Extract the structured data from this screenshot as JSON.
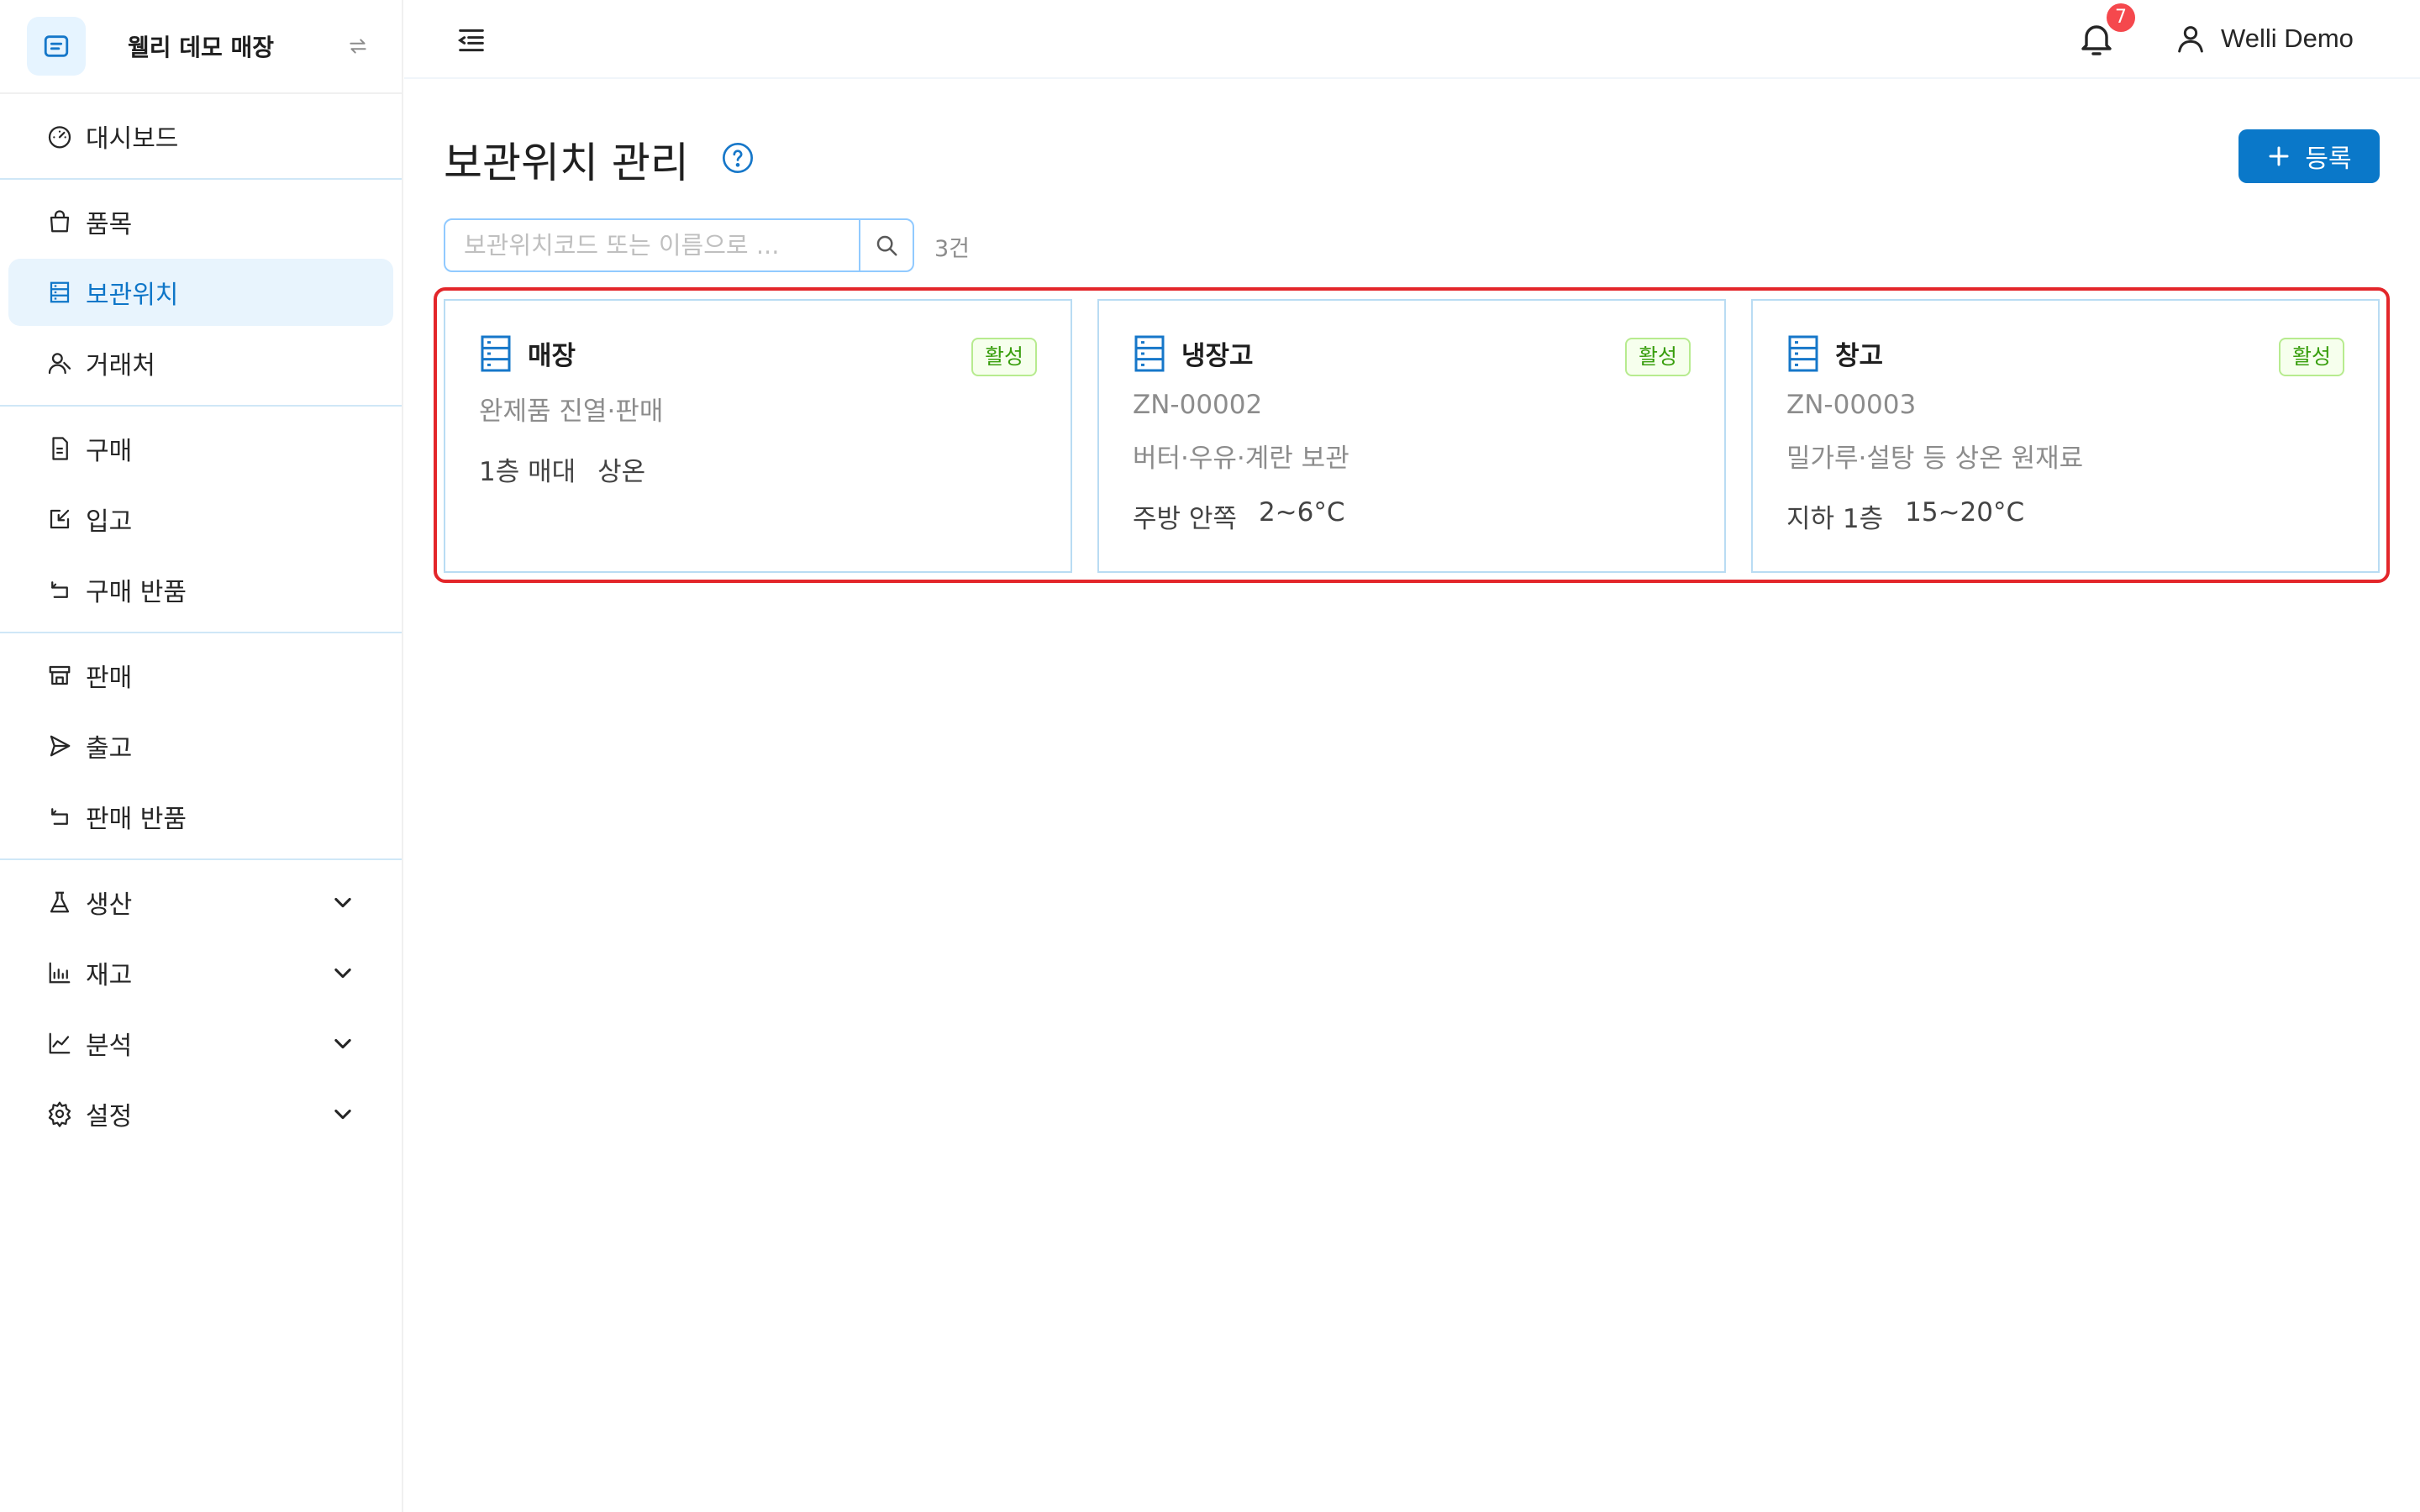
{
  "brand": {
    "name": "웰리 데모 매장"
  },
  "sidebar": {
    "groups": [
      [
        {
          "label": "대시보드",
          "icon": "dashboard-icon"
        }
      ],
      [
        {
          "label": "품목",
          "icon": "bag-icon"
        },
        {
          "label": "보관위치",
          "icon": "storage-icon",
          "active": true
        },
        {
          "label": "거래처",
          "icon": "partners-icon"
        }
      ],
      [
        {
          "label": "구매",
          "icon": "document-icon"
        },
        {
          "label": "입고",
          "icon": "inbound-icon"
        },
        {
          "label": "구매 반품",
          "icon": "return-icon"
        }
      ],
      [
        {
          "label": "판매",
          "icon": "store-icon"
        },
        {
          "label": "출고",
          "icon": "send-icon"
        },
        {
          "label": "판매 반품",
          "icon": "return-icon"
        }
      ],
      [
        {
          "label": "생산",
          "icon": "flask-icon",
          "expandable": true
        },
        {
          "label": "재고",
          "icon": "bar-chart-icon",
          "expandable": true
        },
        {
          "label": "분석",
          "icon": "line-chart-icon",
          "expandable": true
        },
        {
          "label": "설정",
          "icon": "gear-icon",
          "expandable": true
        }
      ]
    ]
  },
  "header": {
    "notification_count": "7",
    "user_name": "Welli Demo"
  },
  "page": {
    "title": "보관위치 관리",
    "add_button_label": "등록",
    "search_placeholder": "보관위치코드 또는 이름으로 ...",
    "search_value": "",
    "result_count": "3건"
  },
  "locations": [
    {
      "name": "매장",
      "status": "활성",
      "code": "",
      "description": "완제품 진열·판매",
      "place": "1층 매대",
      "temperature": "상온"
    },
    {
      "name": "냉장고",
      "status": "활성",
      "code": "ZN-00002",
      "description": "버터·우유·계란 보관",
      "place": "주방 안쪽",
      "temperature": "2~6°C"
    },
    {
      "name": "창고",
      "status": "활성",
      "code": "ZN-00003",
      "description": "밀가루·설탕 등 상온 원재료",
      "place": "지하 1층",
      "temperature": "15~20°C"
    }
  ],
  "colors": {
    "accent": "#0a78c9",
    "active_bg": "#e8f4fd",
    "status_green": "#389e0d",
    "highlight_red": "#e3262a",
    "badge_red": "#f5484d"
  }
}
